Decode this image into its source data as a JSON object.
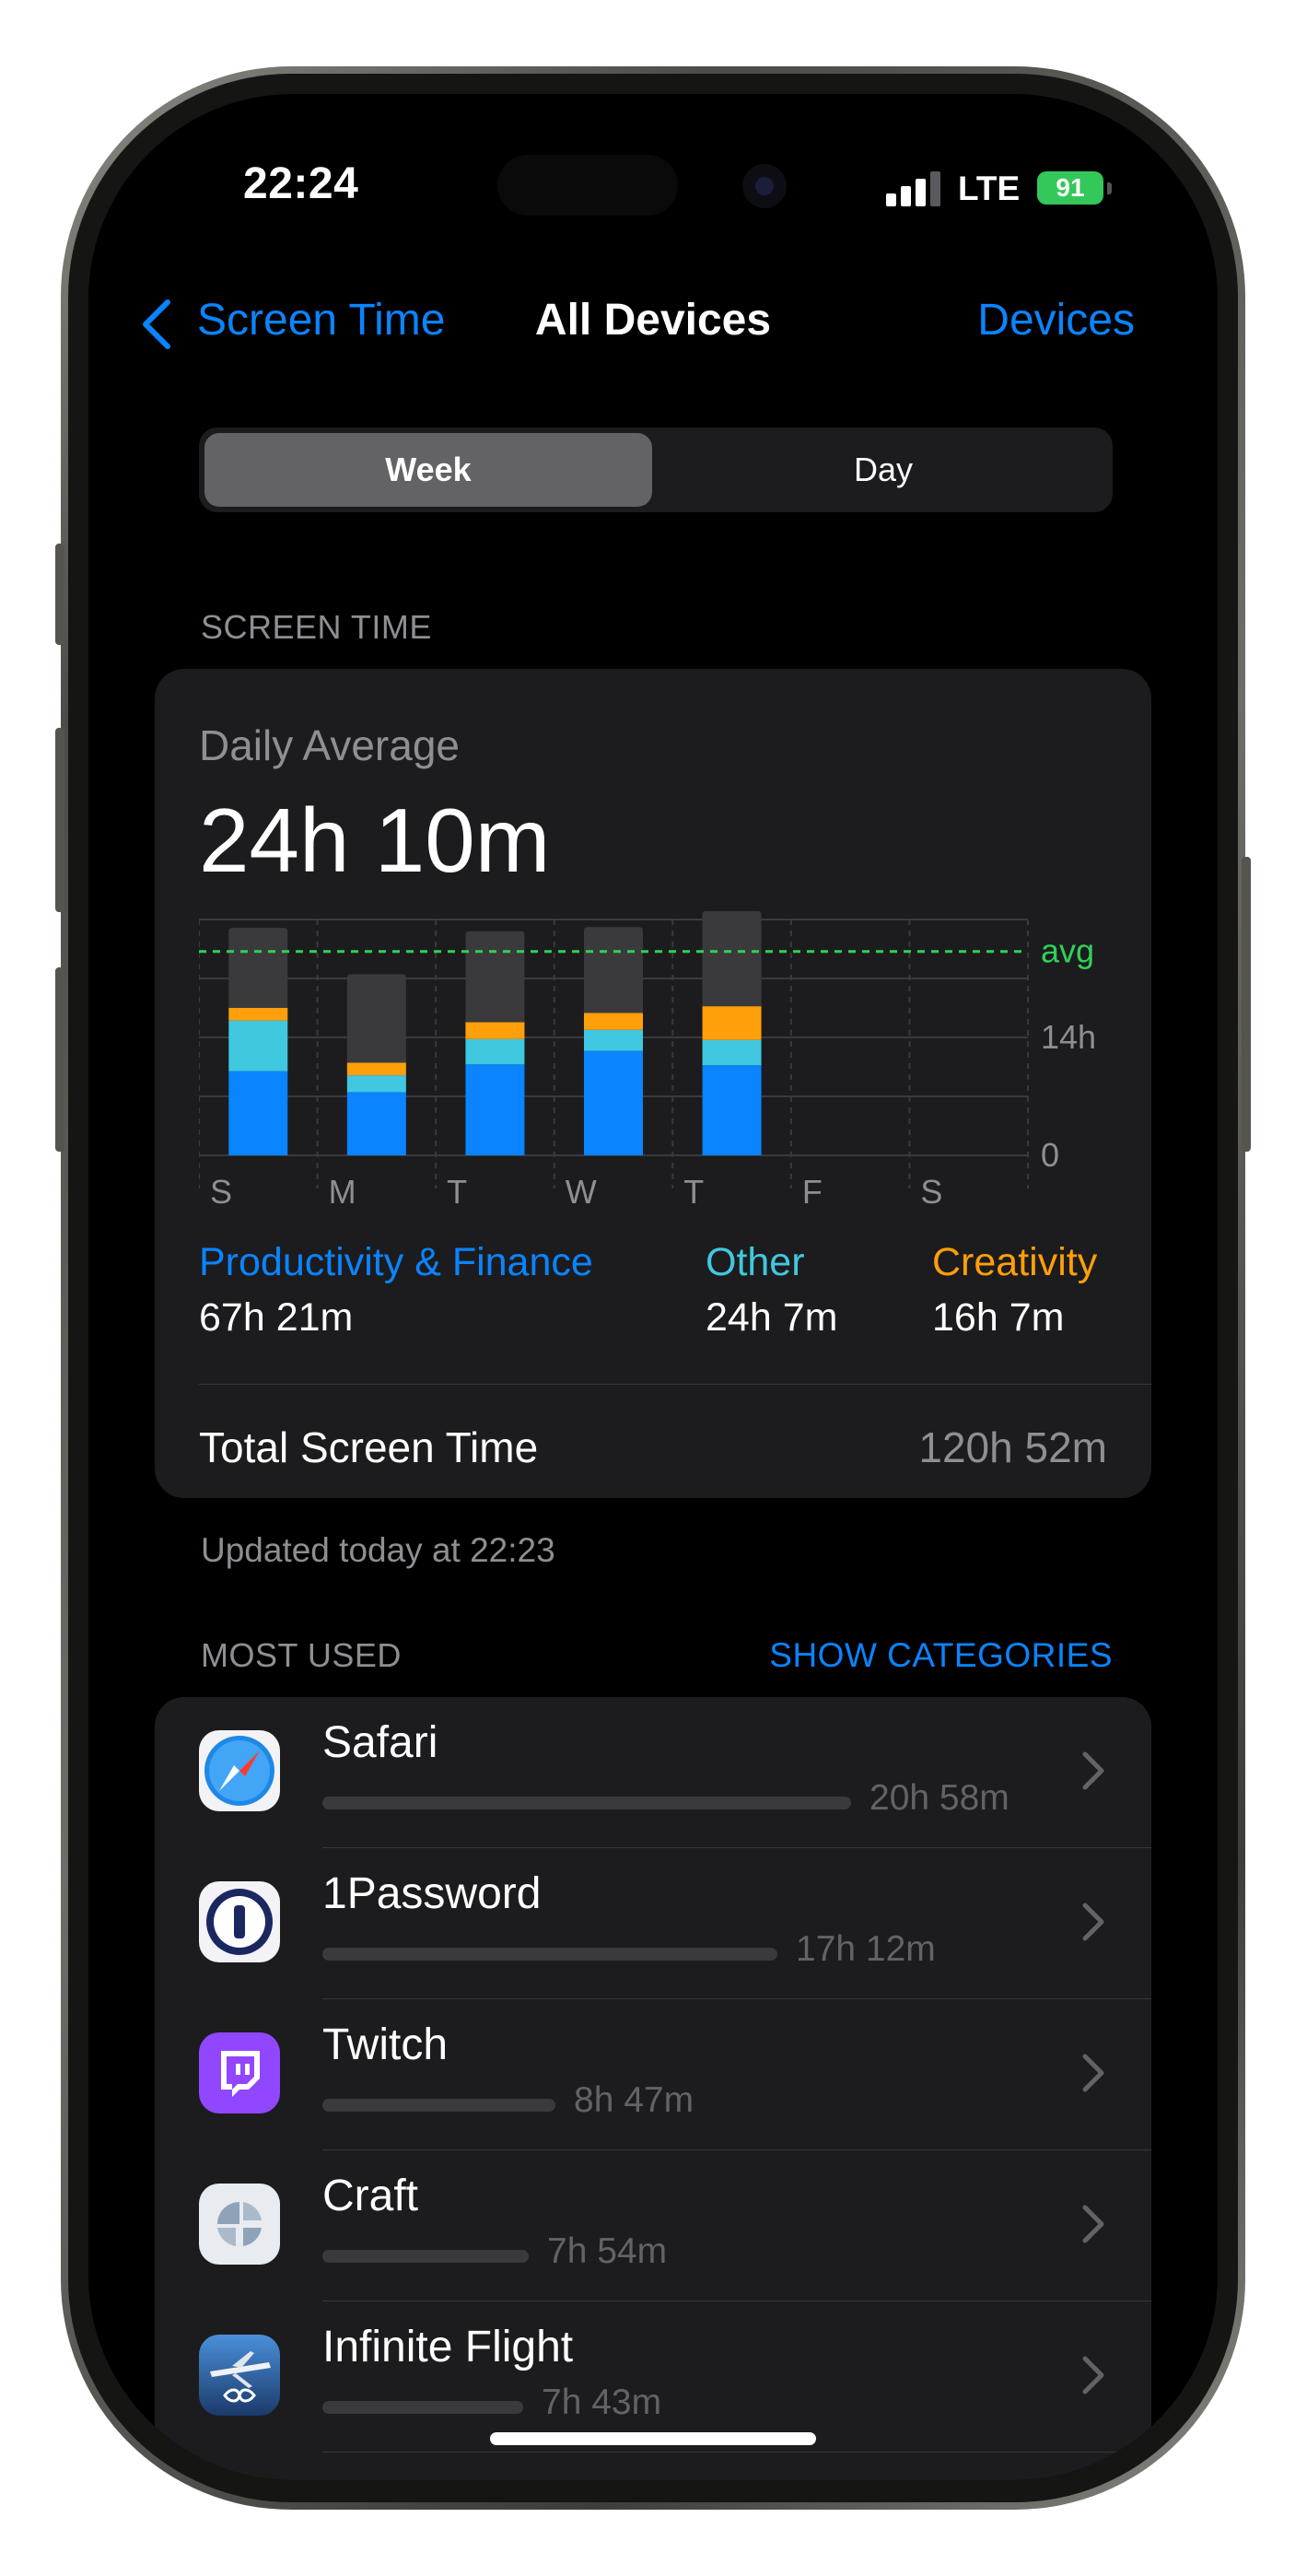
{
  "status": {
    "time": "22:24",
    "network": "LTE",
    "battery": "91"
  },
  "nav": {
    "back_label": "Screen Time",
    "title": "All Devices",
    "right_link": "Devices"
  },
  "segments": {
    "week": "Week",
    "day": "Day",
    "selected": "Week"
  },
  "screen_time": {
    "section_label": "SCREEN TIME",
    "daily_average_label": "Daily Average",
    "daily_average_value": "24h 10m",
    "legend": [
      {
        "name": "Productivity & Finance",
        "value": "67h 21m",
        "color": "#0a84ff"
      },
      {
        "name": "Other",
        "value": "24h 7m",
        "color": "#40c8e0"
      },
      {
        "name": "Creativity",
        "value": "16h 7m",
        "color": "#ff9f0a"
      }
    ],
    "total_label": "Total Screen Time",
    "total_value": "120h 52m",
    "updated_text": "Updated today at 22:23"
  },
  "chart_data": {
    "type": "bar",
    "stacked": true,
    "categories": [
      "S",
      "M",
      "T",
      "W",
      "T",
      "F",
      "S"
    ],
    "series": [
      {
        "name": "Productivity & Finance",
        "color": "#0a84ff",
        "values": [
          10.0,
          7.5,
          10.8,
          12.4,
          10.7,
          0,
          0
        ]
      },
      {
        "name": "Other",
        "color": "#40c8e0",
        "values": [
          6.0,
          2.0,
          3.0,
          2.5,
          3.0,
          0,
          0
        ]
      },
      {
        "name": "Creativity",
        "color": "#ff9f0a",
        "values": [
          1.5,
          1.5,
          2.0,
          2.0,
          4.0,
          0,
          0
        ]
      },
      {
        "color": "#3a3a3c",
        "values": [
          9.5,
          10.5,
          10.8,
          10.2,
          11.3,
          0,
          0
        ]
      }
    ],
    "ytick_labels": [
      "0",
      "14h"
    ],
    "avg_label": "avg",
    "avg_value": 24.2,
    "ylim": [
      0,
      28
    ],
    "avg_color": "#30d158",
    "grid": true
  },
  "most_used": {
    "section_label": "MOST USED",
    "show_categories": "SHOW CATEGORIES",
    "apps": [
      {
        "name": "Safari",
        "time": "20h 58m",
        "icon": "safari-icon",
        "fraction": 1.0
      },
      {
        "name": "1Password",
        "time": "17h 12m",
        "icon": "1password-icon",
        "fraction": 0.86
      },
      {
        "name": "Twitch",
        "time": "8h 47m",
        "icon": "twitch-icon",
        "fraction": 0.44
      },
      {
        "name": "Craft",
        "time": "7h 54m",
        "icon": "craft-icon",
        "fraction": 0.39
      },
      {
        "name": "Infinite Flight",
        "time": "7h 43m",
        "icon": "infinite-flight-icon",
        "fraction": 0.38
      }
    ]
  }
}
